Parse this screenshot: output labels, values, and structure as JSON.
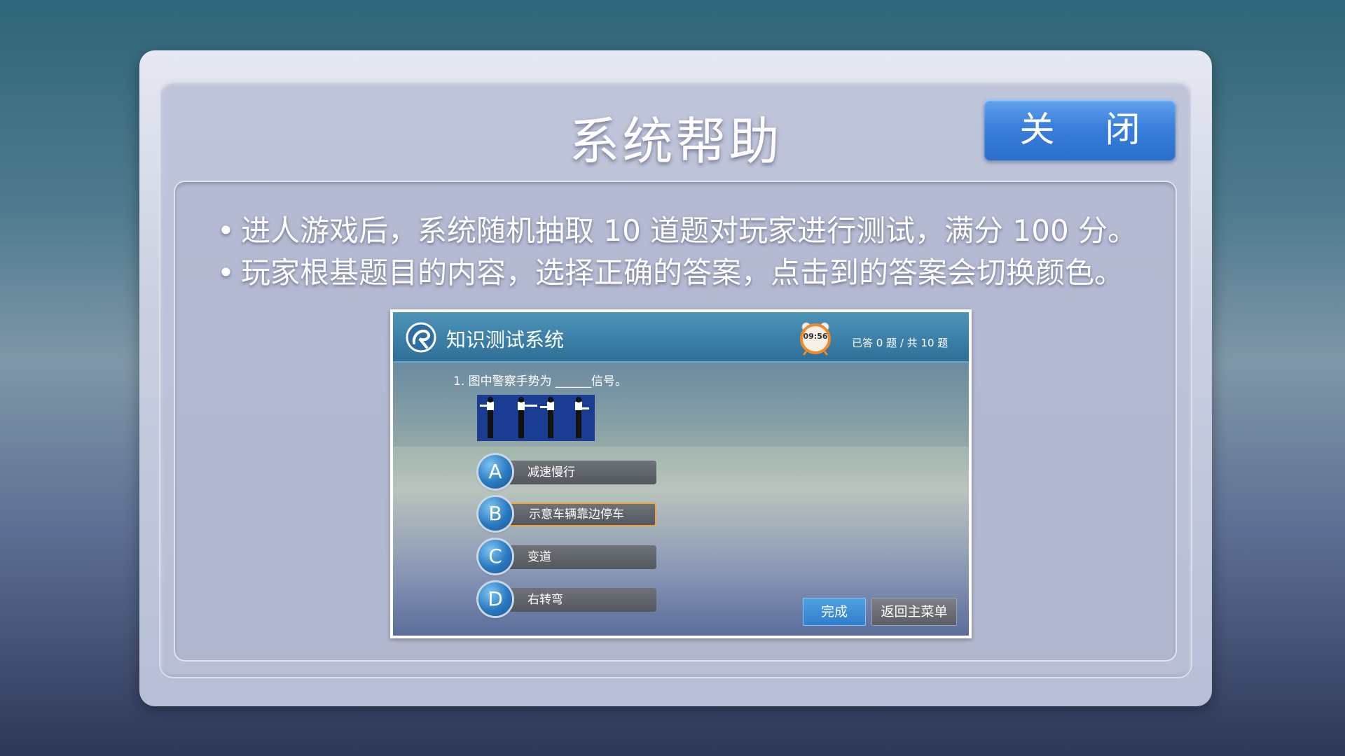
{
  "dialog": {
    "title": "系统帮助",
    "close_label": "关 闭",
    "bullets": [
      "进人游戏后，系统随机抽取 10 道题对玩家进行测试，满分 100 分。",
      "玩家根基题目的内容，选择正确的答案，点击到的答案会切换颜色。"
    ],
    "bullet_glyph": "•"
  },
  "preview": {
    "app_title": "知识测试系统",
    "clock_time": "09:56",
    "progress": "已答  0  题 / 共 10 题",
    "question": "1.   图中警察手势为 ______信号。",
    "options": [
      {
        "letter": "A",
        "text": "减速慢行",
        "selected": false
      },
      {
        "letter": "B",
        "text": "示意车辆靠边停车",
        "selected": true
      },
      {
        "letter": "C",
        "text": "变道",
        "selected": false
      },
      {
        "letter": "D",
        "text": "右转弯",
        "selected": false
      }
    ],
    "done_label": "完成",
    "menu_label": "返回主菜单"
  },
  "colors": {
    "close_button": "#3a7fdb",
    "selected_outline": "#f0a33b",
    "option_circle": "#2a79c0"
  },
  "icons": {
    "logo": "swirl-logo-icon",
    "clock": "alarm-clock-icon"
  }
}
